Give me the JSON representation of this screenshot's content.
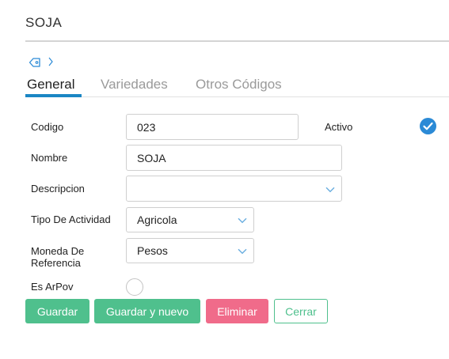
{
  "page": {
    "title": "SOJA"
  },
  "breadcrumb": {
    "icon": "tag-icon",
    "separator_icon": "chevron-right-icon"
  },
  "tabs": [
    {
      "label": "General",
      "active": true
    },
    {
      "label": "Variedades",
      "active": false
    },
    {
      "label": "Otros Códigos",
      "active": false
    }
  ],
  "form": {
    "codigo": {
      "label": "Codigo",
      "value": "023"
    },
    "activo": {
      "label": "Activo",
      "checked": true
    },
    "nombre": {
      "label": "Nombre",
      "value": "SOJA"
    },
    "descripcion": {
      "label": "Descripcion",
      "value": ""
    },
    "tipo_actividad": {
      "label": "Tipo De Actividad",
      "value": "Agricola"
    },
    "moneda": {
      "label_line1": "Moneda De",
      "label_line2": "Referencia",
      "value": "Pesos"
    },
    "es_arpov": {
      "label": "Es ArPov",
      "checked": false
    }
  },
  "buttons": {
    "guardar": "Guardar",
    "guardar_nuevo": "Guardar y nuevo",
    "eliminar": "Eliminar",
    "cerrar": "Cerrar"
  },
  "colors": {
    "accent_blue": "#1b86c4",
    "check_blue": "#2b8ad6",
    "green": "#4fc08d",
    "red": "#f06b8a"
  }
}
